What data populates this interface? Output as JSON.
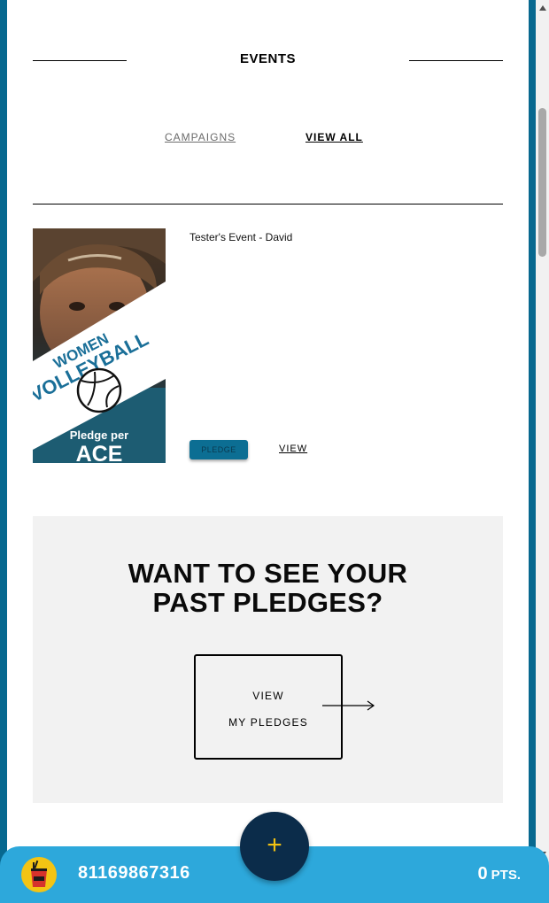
{
  "header": {
    "title": "EVENTS"
  },
  "nav": {
    "campaigns_label": "CAMPAIGNS",
    "view_all_label": "VIEW ALL"
  },
  "event": {
    "name": "Tester's Event - David",
    "image_text": {
      "line1": "WOMEN",
      "line2": "VOLLEYBALL",
      "line3": "Pledge per",
      "line4": "ACE"
    },
    "pledge_label": "PLEDGE",
    "view_label": "VIEW"
  },
  "past_pledges": {
    "heading_line1": "WANT TO SEE YOUR",
    "heading_line2": "PAST PLEDGES?",
    "button_line1": "VIEW",
    "button_line2": "MY PLEDGES"
  },
  "bottom_bar": {
    "phone": "81169867316",
    "points_value": "0",
    "points_label": "PTS.",
    "fab_label": "+",
    "fab_icon": "plus-icon",
    "avatar_icon": "drink-cup-icon"
  },
  "colors": {
    "frame": "#07688f",
    "bottom_bar": "#2da8db",
    "fab": "#0b2c4a",
    "fab_icon": "#f2c112",
    "pledge_button": "#0c6e93"
  }
}
